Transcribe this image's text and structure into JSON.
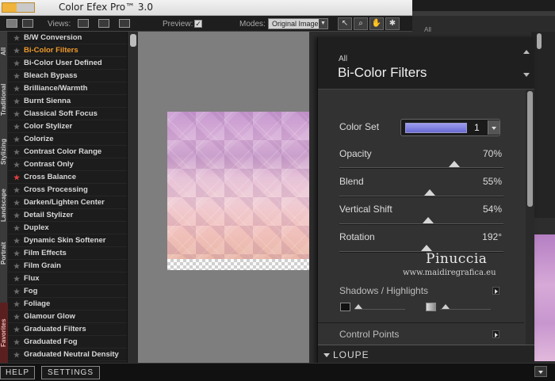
{
  "app": {
    "title": "Color Efex Pro™ 3.0"
  },
  "toolbar": {
    "views_label": "Views:",
    "preview_label": "Preview:",
    "preview_checked": "✓",
    "modes_label": "Modes:",
    "modes_value": "Original Image"
  },
  "vertical_tabs": [
    "All",
    "Traditional",
    "Stylizing",
    "Landscape",
    "Portrait",
    "Favorites"
  ],
  "filters": [
    {
      "label": "B/W Conversion",
      "active": false,
      "fav": false
    },
    {
      "label": "Bi-Color Filters",
      "active": true,
      "fav": false
    },
    {
      "label": "Bi-Color User Defined",
      "active": false,
      "fav": false
    },
    {
      "label": "Bleach Bypass",
      "active": false,
      "fav": false
    },
    {
      "label": "Brilliance/Warmth",
      "active": false,
      "fav": false
    },
    {
      "label": "Burnt Sienna",
      "active": false,
      "fav": false
    },
    {
      "label": "Classical Soft Focus",
      "active": false,
      "fav": false
    },
    {
      "label": "Color Stylizer",
      "active": false,
      "fav": false
    },
    {
      "label": "Colorize",
      "active": false,
      "fav": false
    },
    {
      "label": "Contrast Color Range",
      "active": false,
      "fav": false
    },
    {
      "label": "Contrast Only",
      "active": false,
      "fav": false
    },
    {
      "label": "Cross Balance",
      "active": false,
      "fav": true
    },
    {
      "label": "Cross Processing",
      "active": false,
      "fav": false
    },
    {
      "label": "Darken/Lighten Center",
      "active": false,
      "fav": false
    },
    {
      "label": "Detail Stylizer",
      "active": false,
      "fav": false
    },
    {
      "label": "Duplex",
      "active": false,
      "fav": false
    },
    {
      "label": "Dynamic Skin Softener",
      "active": false,
      "fav": false
    },
    {
      "label": "Film Effects",
      "active": false,
      "fav": false
    },
    {
      "label": "Film Grain",
      "active": false,
      "fav": false
    },
    {
      "label": "Flux",
      "active": false,
      "fav": false
    },
    {
      "label": "Fog",
      "active": false,
      "fav": false
    },
    {
      "label": "Foliage",
      "active": false,
      "fav": false
    },
    {
      "label": "Glamour Glow",
      "active": false,
      "fav": false
    },
    {
      "label": "Graduated Filters",
      "active": false,
      "fav": false
    },
    {
      "label": "Graduated Fog",
      "active": false,
      "fav": false
    },
    {
      "label": "Graduated Neutral Density",
      "active": false,
      "fav": false
    }
  ],
  "bottom": {
    "help": "HELP",
    "settings": "SETTINGS"
  },
  "background_panel": {
    "all_label": "All"
  },
  "panel": {
    "category": "All",
    "title": "Bi-Color Filters",
    "color_set": {
      "label": "Color Set",
      "value": "1",
      "swatch_color": "#7b7be0"
    },
    "sliders": [
      {
        "label": "Opacity",
        "value": "70%",
        "level": 0.7
      },
      {
        "label": "Blend",
        "value": "55%",
        "level": 0.55
      },
      {
        "label": "Vertical Shift",
        "value": "54%",
        "level": 0.54
      },
      {
        "label": "Rotation",
        "value": "192°",
        "level": 0.53
      }
    ],
    "watermark": {
      "name": "Pinuccia",
      "url": "www.maidiregrafica.eu"
    },
    "shadows_highlights": "Shadows / Highlights",
    "control_points": "Control Points",
    "loupe": "LOUPE"
  },
  "colors": {
    "accent": "#f09a2a",
    "favorite_star": "#e04040"
  }
}
